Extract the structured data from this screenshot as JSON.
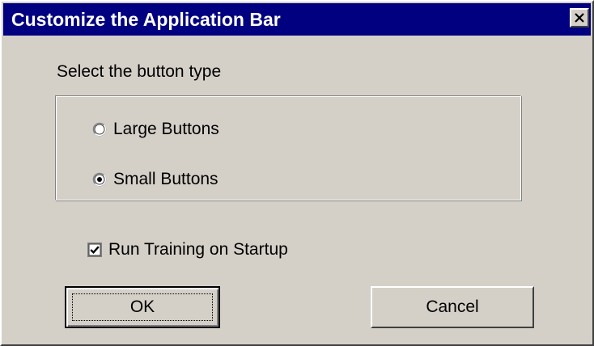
{
  "window": {
    "title": "Customize the Application Bar"
  },
  "button_type": {
    "label": "Select the button type",
    "options": [
      {
        "label": "Large Buttons",
        "selected": false
      },
      {
        "label": "Small Buttons",
        "selected": true
      }
    ]
  },
  "run_training": {
    "label": "Run Training on Startup",
    "checked": true
  },
  "buttons": {
    "ok_label": "OK",
    "cancel_label": "Cancel"
  }
}
